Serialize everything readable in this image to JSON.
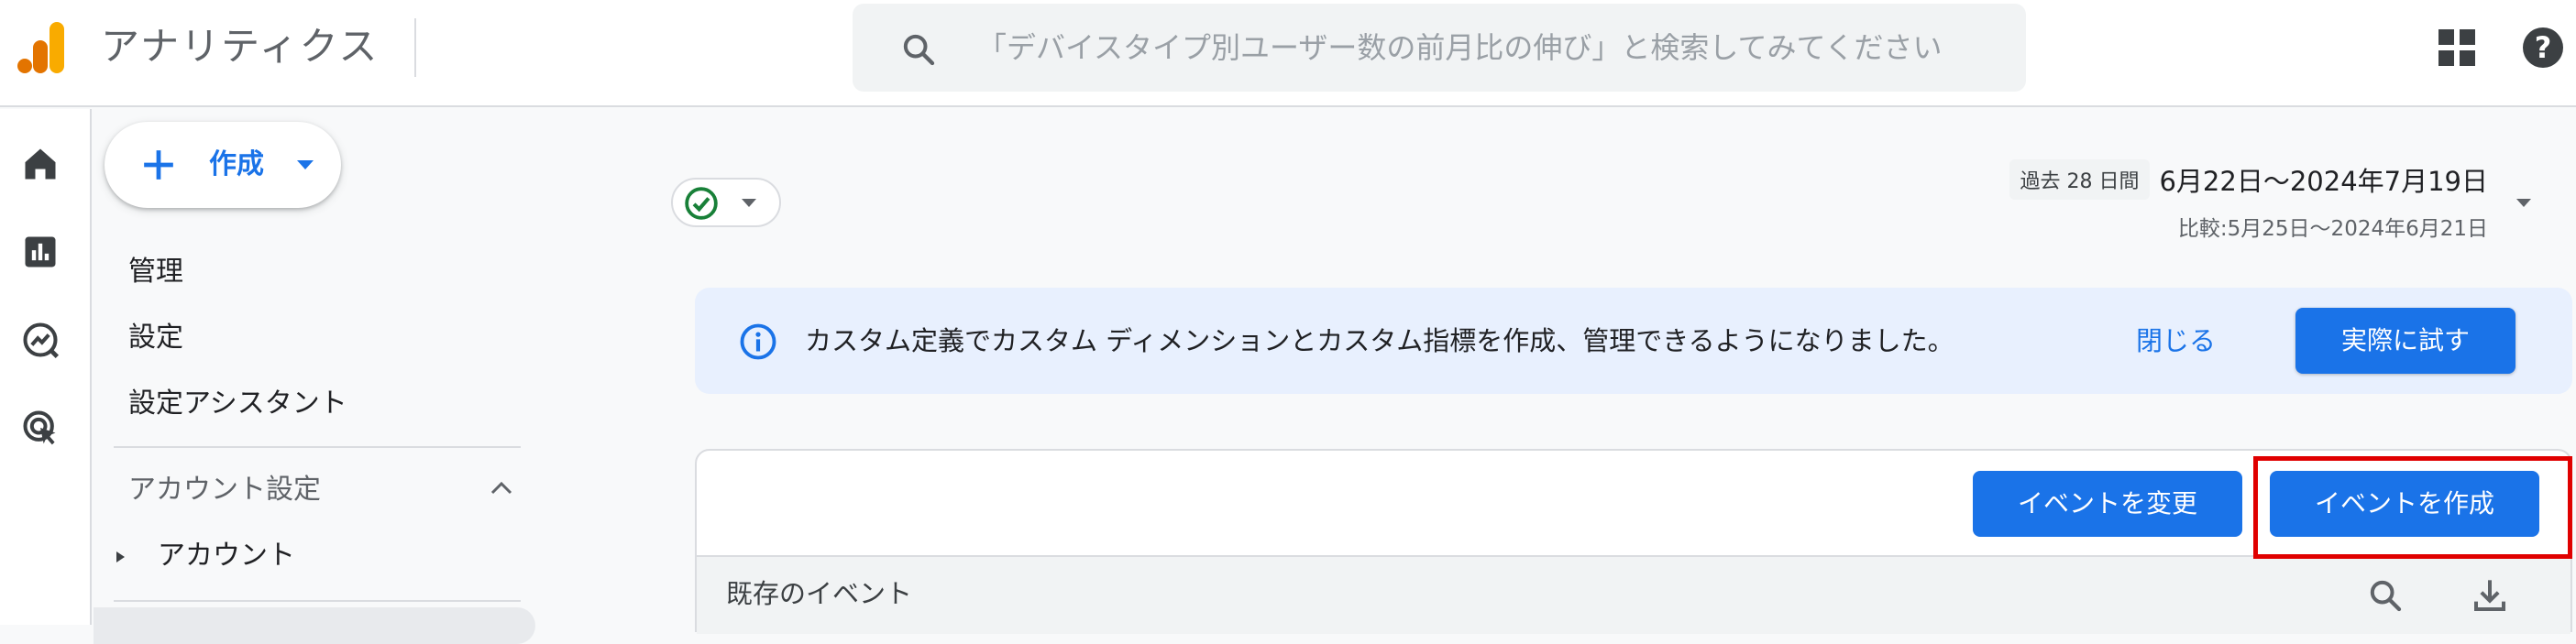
{
  "app": {
    "title": "アナリティクス"
  },
  "search": {
    "placeholder": "「デバイスタイプ別ユーザー数の前月比の伸び」と検索してみてください"
  },
  "sidebar": {
    "create_label": "作成",
    "items": [
      "管理",
      "設定",
      "設定アシスタント"
    ],
    "section_title": "アカウント設定",
    "section_items": [
      "アカウント"
    ]
  },
  "date_range": {
    "chip": "過去 28 日間",
    "main": "6月22日～2024年7月19日",
    "compare": "比較:5月25日～2024年6月21日"
  },
  "banner": {
    "message": "カスタム定義でカスタム ディメンションとカスタム指標を作成、管理できるようになりました。",
    "close_label": "閉じる",
    "try_label": "実際に試す"
  },
  "events": {
    "modify_label": "イベントを変更",
    "create_label": "イベントを作成",
    "existing_title": "既存のイベント"
  },
  "icons": {
    "rail": [
      "home-icon",
      "reports-icon",
      "explore-icon",
      "advertising-icon"
    ],
    "header": [
      "search-icon",
      "apps-icon",
      "help-icon"
    ]
  },
  "colors": {
    "accent": "#1a73e8",
    "logo_orange": "#f9ab00",
    "logo_dark": "#e37400",
    "success": "#188038",
    "highlight": "#e00000",
    "banner_bg": "#e8f0fe"
  }
}
